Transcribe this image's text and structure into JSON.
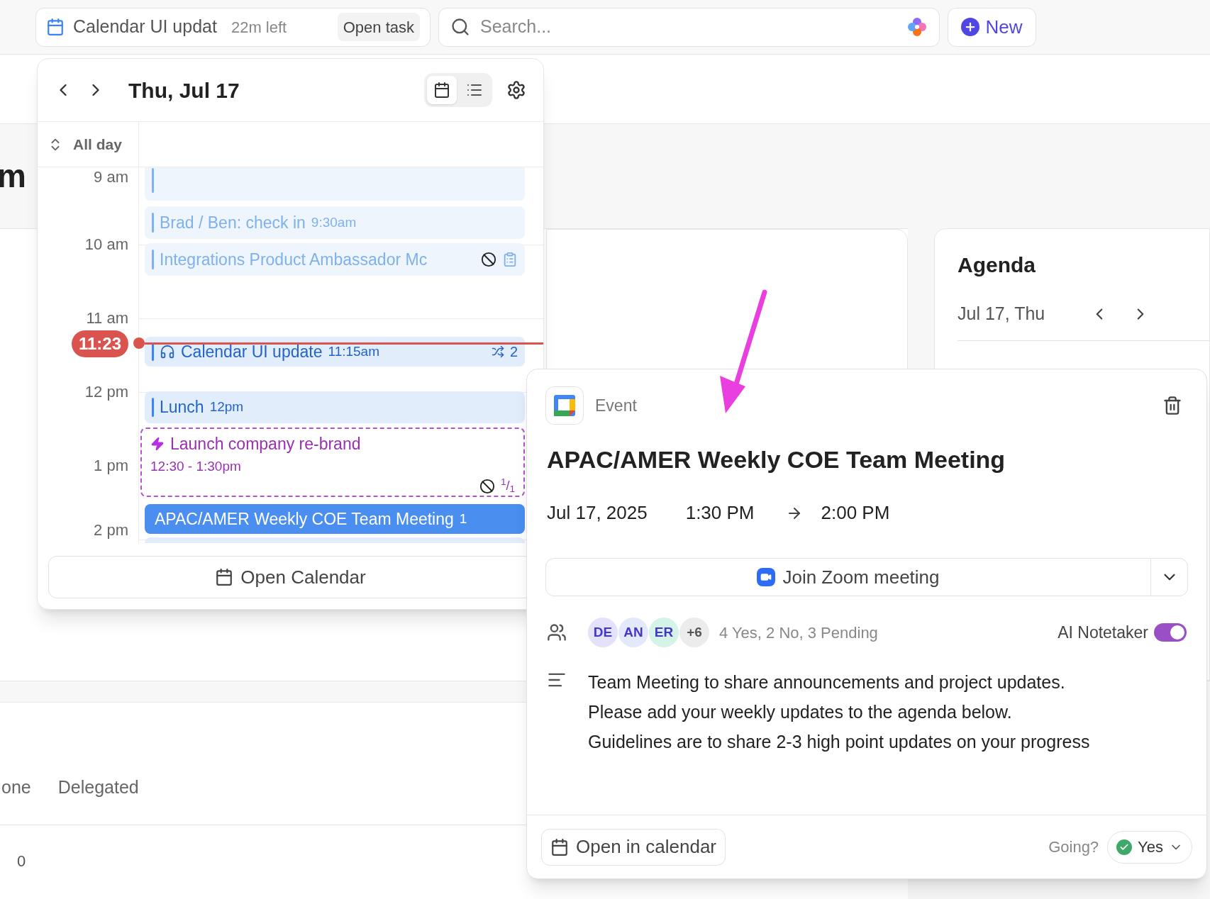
{
  "top_bar": {
    "task": {
      "title": "Calendar UI updat",
      "time_left": "22m left",
      "action": "Open task"
    },
    "search": {
      "placeholder": "Search..."
    },
    "new_button": "New"
  },
  "page": {
    "heading": "m",
    "tabs": [
      "one",
      "Delegated"
    ],
    "count": "0"
  },
  "agenda": {
    "title": "Agenda",
    "date": "Jul 17, Thu"
  },
  "calendar": {
    "date": "Thu, Jul 17",
    "views": [
      {
        "kind": "calendar",
        "selected": true
      },
      {
        "kind": "list",
        "selected": false
      }
    ],
    "all_day": "All day",
    "hours": [
      "9 am",
      "10 am",
      "11 am",
      "12 pm",
      "1 pm",
      "2 pm"
    ],
    "now": "11:23",
    "events": [
      {
        "kind": "event",
        "past": true,
        "selected": false
      },
      {
        "kind": "event",
        "past": true,
        "selected": false,
        "title": "Brad / Ben: check in",
        "time": "9:30am"
      },
      {
        "kind": "event",
        "past": true,
        "selected": false,
        "title": "Integrations Product Ambassador Mc",
        "declined": true,
        "notes": true
      },
      {
        "kind": "task",
        "past": false,
        "selected": false,
        "title": "Calendar UI update",
        "time": "11:15am",
        "subtasks": "2"
      },
      {
        "kind": "event",
        "past": false,
        "selected": false,
        "title": "Lunch",
        "time": "12pm"
      },
      {
        "kind": "task_block",
        "past": false,
        "selected": false,
        "title": "Launch company re-brand",
        "time": "12:30 - 1:30pm",
        "declined": true,
        "count": "$^{1}$/$_{1}$"
      },
      {
        "kind": "event",
        "past": false,
        "selected": true,
        "title": "APAC/AMER Weekly COE Team Meeting",
        "time": "1"
      },
      {
        "kind": "event",
        "past": false,
        "selected": false
      }
    ],
    "open_button": "Open Calendar"
  },
  "event": {
    "source": "Event",
    "title": "APAC/AMER Weekly COE Team Meeting",
    "date": "Jul 17, 2025",
    "start": "1:30 PM",
    "end": "2:00 PM",
    "join": "Join Zoom meeting",
    "attendees": [
      {
        "initials": "DE",
        "color": "#e4e2fb"
      },
      {
        "initials": "AN",
        "color": "#e3e8fb"
      },
      {
        "initials": "ER",
        "color": "#d5f3e7"
      }
    ],
    "more": "+6",
    "rsvp_summary": "4 Yes, 2 No, 3 Pending",
    "notetaker": {
      "label": "AI Notetaker",
      "on": true
    },
    "description": [
      "Team Meeting to share announcements and project updates.",
      "Please add your weekly updates to the agenda below.",
      "Guidelines are to share 2-3 high point updates on your progress"
    ],
    "open_button": "Open in calendar",
    "going": {
      "label": "Going?",
      "value": "Yes"
    }
  }
}
